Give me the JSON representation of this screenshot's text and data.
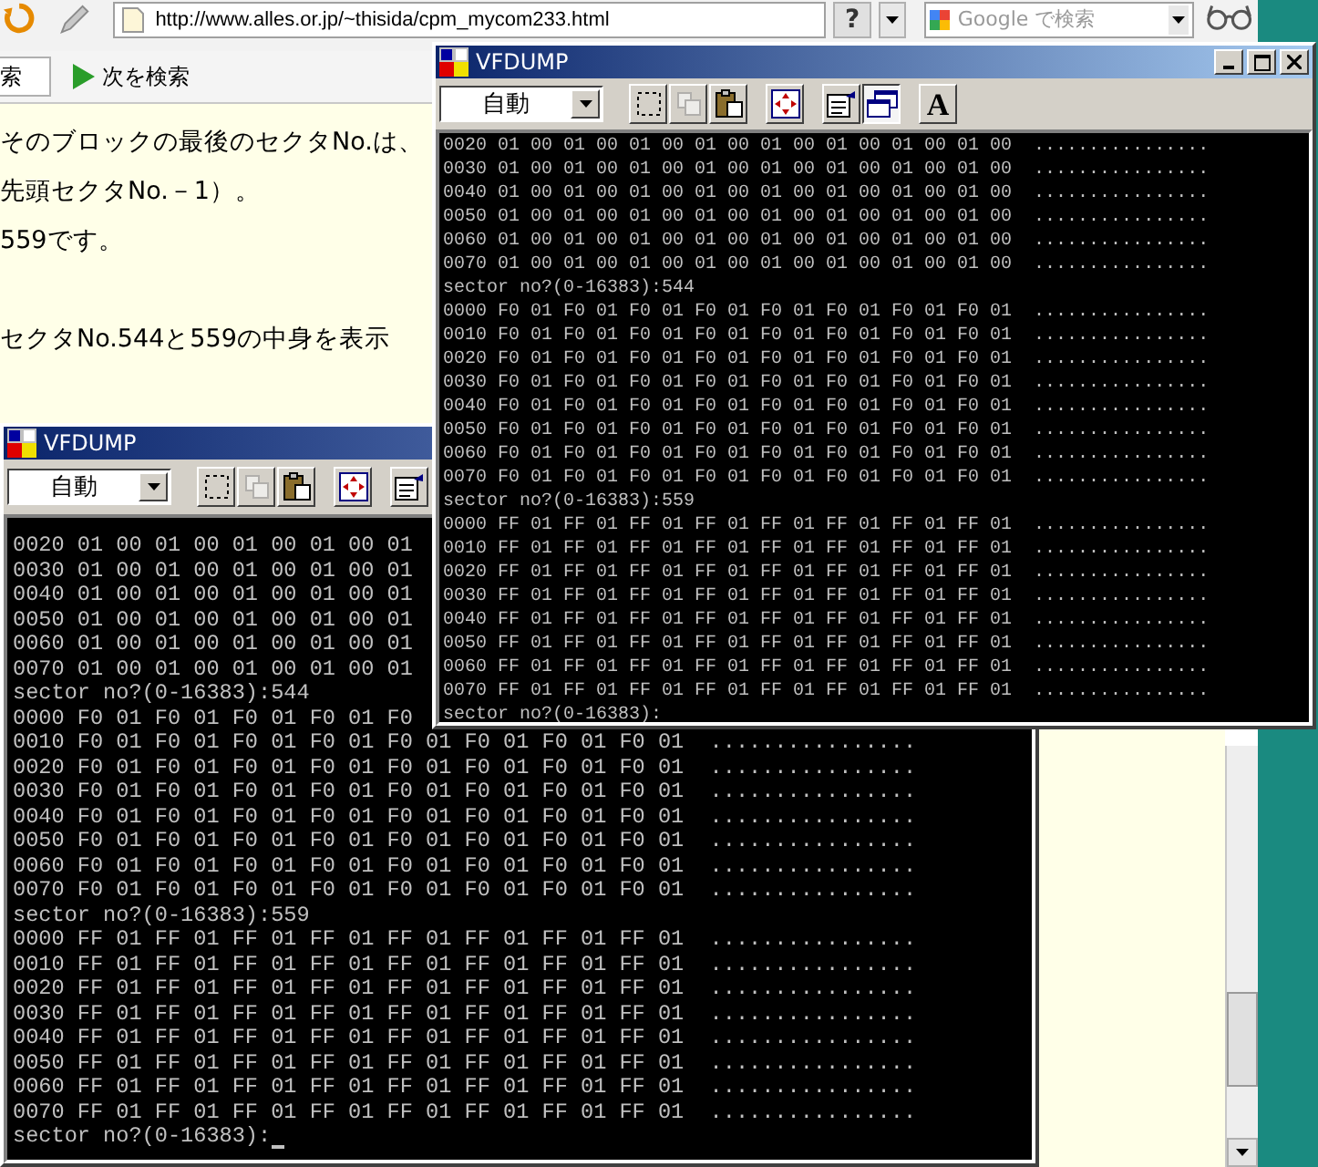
{
  "browser": {
    "url": "http://www.alles.or.jp/~thisida/cpm_mycom233.html",
    "help_button": "?",
    "search_placeholder": "Google で検索",
    "find_field": "索",
    "find_next_button": "次を検索"
  },
  "page": {
    "blocks": [
      {
        "lines": [
          "そのブロックの最後のセクタNo.は、",
          "先頭セクタNo.－1）。",
          "559です。"
        ]
      },
      {
        "lines": [
          "セクタNo.544と559の中身を表示"
        ]
      }
    ]
  },
  "windows": [
    {
      "title": "VFDUMP",
      "mode": "自動",
      "active": true,
      "cursor": false,
      "buttons": [
        {
          "kind": "mark",
          "disabled": false,
          "selected": false
        },
        {
          "kind": "copy",
          "disabled": true,
          "selected": false
        },
        {
          "kind": "paste",
          "disabled": false,
          "selected": false
        },
        {
          "kind": "fullscreen",
          "disabled": false,
          "selected": false
        },
        {
          "kind": "properties",
          "disabled": false,
          "selected": false
        },
        {
          "kind": "background",
          "disabled": false,
          "selected": true
        },
        {
          "kind": "font",
          "label": "A",
          "disabled": false,
          "selected": false
        }
      ],
      "lines": [
        "0020 01 00 01 00 01 00 01 00 01 00 01 00 01 00 01 00  ................",
        "0030 01 00 01 00 01 00 01 00 01 00 01 00 01 00 01 00  ................",
        "0040 01 00 01 00 01 00 01 00 01 00 01 00 01 00 01 00  ................",
        "0050 01 00 01 00 01 00 01 00 01 00 01 00 01 00 01 00  ................",
        "0060 01 00 01 00 01 00 01 00 01 00 01 00 01 00 01 00  ................",
        "0070 01 00 01 00 01 00 01 00 01 00 01 00 01 00 01 00  ................",
        "sector no?(0-16383):544",
        "0000 F0 01 F0 01 F0 01 F0 01 F0 01 F0 01 F0 01 F0 01  ................",
        "0010 F0 01 F0 01 F0 01 F0 01 F0 01 F0 01 F0 01 F0 01  ................",
        "0020 F0 01 F0 01 F0 01 F0 01 F0 01 F0 01 F0 01 F0 01  ................",
        "0030 F0 01 F0 01 F0 01 F0 01 F0 01 F0 01 F0 01 F0 01  ................",
        "0040 F0 01 F0 01 F0 01 F0 01 F0 01 F0 01 F0 01 F0 01  ................",
        "0050 F0 01 F0 01 F0 01 F0 01 F0 01 F0 01 F0 01 F0 01  ................",
        "0060 F0 01 F0 01 F0 01 F0 01 F0 01 F0 01 F0 01 F0 01  ................",
        "0070 F0 01 F0 01 F0 01 F0 01 F0 01 F0 01 F0 01 F0 01  ................",
        "sector no?(0-16383):559",
        "0000 FF 01 FF 01 FF 01 FF 01 FF 01 FF 01 FF 01 FF 01  ................",
        "0010 FF 01 FF 01 FF 01 FF 01 FF 01 FF 01 FF 01 FF 01  ................",
        "0020 FF 01 FF 01 FF 01 FF 01 FF 01 FF 01 FF 01 FF 01  ................",
        "0030 FF 01 FF 01 FF 01 FF 01 FF 01 FF 01 FF 01 FF 01  ................",
        "0040 FF 01 FF 01 FF 01 FF 01 FF 01 FF 01 FF 01 FF 01  ................",
        "0050 FF 01 FF 01 FF 01 FF 01 FF 01 FF 01 FF 01 FF 01  ................",
        "0060 FF 01 FF 01 FF 01 FF 01 FF 01 FF 01 FF 01 FF 01  ................",
        "0070 FF 01 FF 01 FF 01 FF 01 FF 01 FF 01 FF 01 FF 01  ................",
        "sector no?(0-16383):"
      ]
    },
    {
      "title": "VFDUMP",
      "mode": "自動",
      "active": false,
      "cursor": true,
      "buttons": [
        {
          "kind": "mark",
          "disabled": false,
          "selected": false
        },
        {
          "kind": "copy",
          "disabled": true,
          "selected": false
        },
        {
          "kind": "paste",
          "disabled": false,
          "selected": false
        },
        {
          "kind": "fullscreen",
          "disabled": false,
          "selected": false
        },
        {
          "kind": "properties",
          "disabled": false,
          "selected": false
        }
      ],
      "lines": [
        "0020 01 00 01 00 01 00 01 00 01",
        "0030 01 00 01 00 01 00 01 00 01",
        "0040 01 00 01 00 01 00 01 00 01",
        "0050 01 00 01 00 01 00 01 00 01",
        "0060 01 00 01 00 01 00 01 00 01",
        "0070 01 00 01 00 01 00 01 00 01",
        "sector no?(0-16383):544",
        "0000 F0 01 F0 01 F0 01 F0 01 F0",
        "0010 F0 01 F0 01 F0 01 F0 01 F0 01 F0 01 F0 01 F0 01  ................",
        "0020 F0 01 F0 01 F0 01 F0 01 F0 01 F0 01 F0 01 F0 01  ................",
        "0030 F0 01 F0 01 F0 01 F0 01 F0 01 F0 01 F0 01 F0 01  ................",
        "0040 F0 01 F0 01 F0 01 F0 01 F0 01 F0 01 F0 01 F0 01  ................",
        "0050 F0 01 F0 01 F0 01 F0 01 F0 01 F0 01 F0 01 F0 01  ................",
        "0060 F0 01 F0 01 F0 01 F0 01 F0 01 F0 01 F0 01 F0 01  ................",
        "0070 F0 01 F0 01 F0 01 F0 01 F0 01 F0 01 F0 01 F0 01  ................",
        "sector no?(0-16383):559",
        "0000 FF 01 FF 01 FF 01 FF 01 FF 01 FF 01 FF 01 FF 01  ................",
        "0010 FF 01 FF 01 FF 01 FF 01 FF 01 FF 01 FF 01 FF 01  ................",
        "0020 FF 01 FF 01 FF 01 FF 01 FF 01 FF 01 FF 01 FF 01  ................",
        "0030 FF 01 FF 01 FF 01 FF 01 FF 01 FF 01 FF 01 FF 01  ................",
        "0040 FF 01 FF 01 FF 01 FF 01 FF 01 FF 01 FF 01 FF 01  ................",
        "0050 FF 01 FF 01 FF 01 FF 01 FF 01 FF 01 FF 01 FF 01  ................",
        "0060 FF 01 FF 01 FF 01 FF 01 FF 01 FF 01 FF 01 FF 01  ................",
        "0070 FF 01 FF 01 FF 01 FF 01 FF 01 FF 01 FF 01 FF 01  ................",
        "sector no?(0-16383):"
      ]
    }
  ]
}
